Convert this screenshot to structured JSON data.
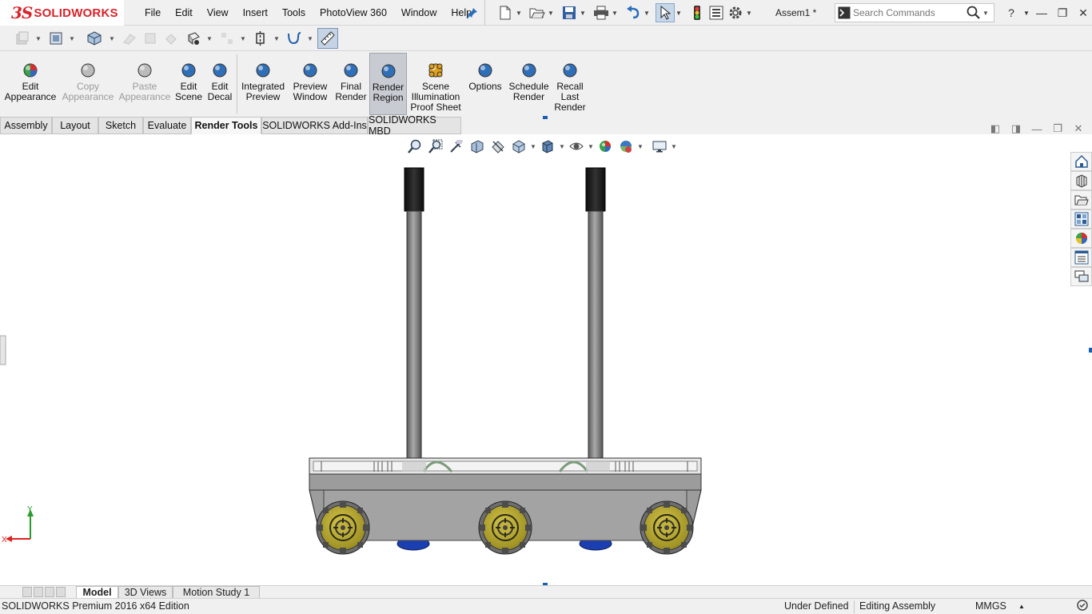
{
  "app": {
    "logo_ds": "3S",
    "logo_name": "SOLIDWORKS",
    "doc_title": "Assem1 *"
  },
  "menu": [
    "File",
    "Edit",
    "View",
    "Insert",
    "Tools",
    "PhotoView 360",
    "Window",
    "Help"
  ],
  "search": {
    "placeholder": "Search Commands"
  },
  "ribbon": {
    "buttons": [
      {
        "label1": "Edit",
        "label2": "Appearance",
        "label3": "",
        "icon": "appearance-icon",
        "disabled": false
      },
      {
        "label1": "Copy",
        "label2": "Appearance",
        "label3": "",
        "icon": "copy-appearance-icon",
        "disabled": true
      },
      {
        "label1": "Paste",
        "label2": "Appearance",
        "label3": "",
        "icon": "paste-appearance-icon",
        "disabled": true
      },
      {
        "label1": "Edit",
        "label2": "Scene",
        "label3": "",
        "icon": "scene-icon",
        "disabled": false
      },
      {
        "label1": "Edit",
        "label2": "Decal",
        "label3": "",
        "icon": "decal-icon",
        "disabled": false
      },
      {
        "label1": "Integrated",
        "label2": "Preview",
        "label3": "",
        "icon": "integrated-preview-icon",
        "disabled": false
      },
      {
        "label1": "Preview",
        "label2": "Window",
        "label3": "",
        "icon": "preview-window-icon",
        "disabled": false
      },
      {
        "label1": "Final",
        "label2": "Render",
        "label3": "",
        "icon": "final-render-icon",
        "disabled": false
      },
      {
        "label1": "Render",
        "label2": "Region",
        "label3": "",
        "icon": "render-region-icon",
        "disabled": false,
        "active": true
      },
      {
        "label1": "Scene",
        "label2": "Illumination",
        "label3": "Proof Sheet",
        "icon": "illumination-icon",
        "disabled": false
      },
      {
        "label1": "Options",
        "label2": "",
        "label3": "",
        "icon": "options-icon",
        "disabled": false
      },
      {
        "label1": "Schedule",
        "label2": "Render",
        "label3": "",
        "icon": "schedule-render-icon",
        "disabled": false
      },
      {
        "label1": "Recall",
        "label2": "Last",
        "label3": "Render",
        "icon": "recall-render-icon",
        "disabled": false
      }
    ]
  },
  "tabs": [
    {
      "label": "Assembly"
    },
    {
      "label": "Layout"
    },
    {
      "label": "Sketch"
    },
    {
      "label": "Evaluate"
    },
    {
      "label": "Render Tools",
      "active": true
    },
    {
      "label": "SOLIDWORKS Add-Ins"
    },
    {
      "label": "SOLIDWORKS MBD"
    }
  ],
  "triad": {
    "y_label": "Y",
    "x_label": "X"
  },
  "bottom_tabs": [
    {
      "label": "Model",
      "active": true
    },
    {
      "label": "3D Views"
    },
    {
      "label": "Motion Study 1"
    }
  ],
  "status": {
    "edition": "SOLIDWORKS Premium 2016 x64 Edition",
    "state": "Under Defined",
    "mode": "Editing Assembly",
    "units": "MMGS"
  },
  "colors": {
    "viewport_border": "#cc33cc",
    "brand_red": "#d8232a",
    "wheel_yellow": "#b8a82a",
    "chassis_gray": "#9a9a9a"
  }
}
